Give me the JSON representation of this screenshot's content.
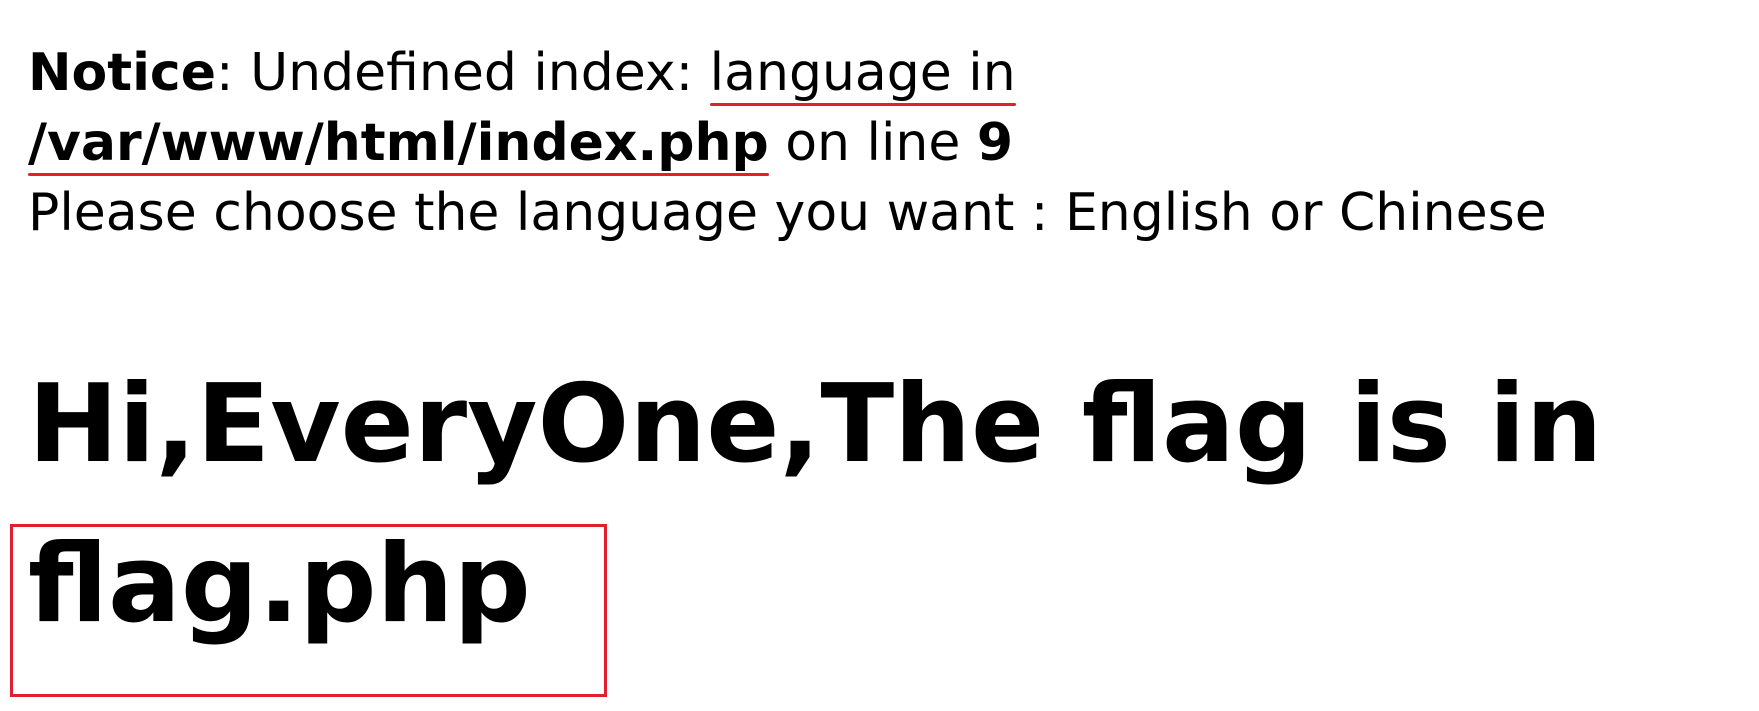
{
  "notice": {
    "label": "Notice",
    "colon": ": ",
    "message_before": "Undefined index: ",
    "message_highlight": "language in",
    "file_path": "/var/www/html/index.php",
    "on_line_text": " on line ",
    "line_number": "9"
  },
  "prompt_text": "Please choose the language you want : English or Chinese",
  "heading": {
    "line1": "Hi,EveryOne,The flag is in",
    "line2": "flag.php"
  },
  "colors": {
    "annotation": "#e0202e",
    "text": "#000000",
    "background": "#ffffff"
  }
}
